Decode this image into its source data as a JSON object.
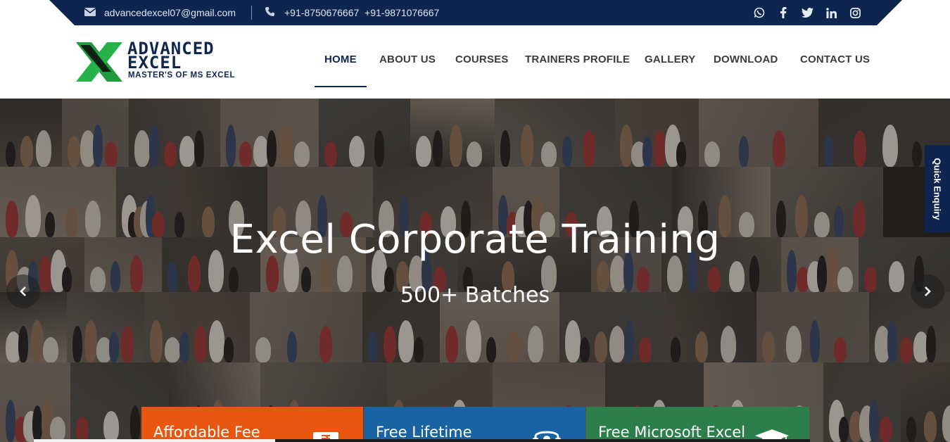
{
  "topbar": {
    "email": "advancedexcel07@gmail.com",
    "phone": "+91-8750676667  +91-9871076667",
    "social_icons": [
      "whatsapp-icon",
      "facebook-icon",
      "twitter-icon",
      "linkedin-icon",
      "instagram-icon"
    ]
  },
  "logo": {
    "line1": "ADVANCED",
    "line2": "EXCEL",
    "tagline": "MASTER'S OF MS EXCEL"
  },
  "nav": {
    "items": [
      "HOME",
      "ABOUT US",
      "COURSES",
      "TRAINERS PROFILE",
      "GALLERY",
      "DOWNLOAD",
      "CONTACT US"
    ],
    "active": "HOME"
  },
  "hero": {
    "title": "Excel Corporate Training",
    "subtitle": "500+ Batches"
  },
  "quick_enquiry": "Quick Enquiry",
  "features": [
    {
      "label": "Affordable Fee",
      "color": "#e8560f",
      "icon": "rupee-icon"
    },
    {
      "label": "Free Lifetime",
      "color": "#1a63a3",
      "icon": "support-icon"
    },
    {
      "label": "Free Microsoft Excel",
      "color": "#2c7e4a",
      "icon": "graduation-cap-icon"
    }
  ],
  "colors": {
    "brand_navy": "#0e2550",
    "logo_green": "#1f9a3c"
  }
}
